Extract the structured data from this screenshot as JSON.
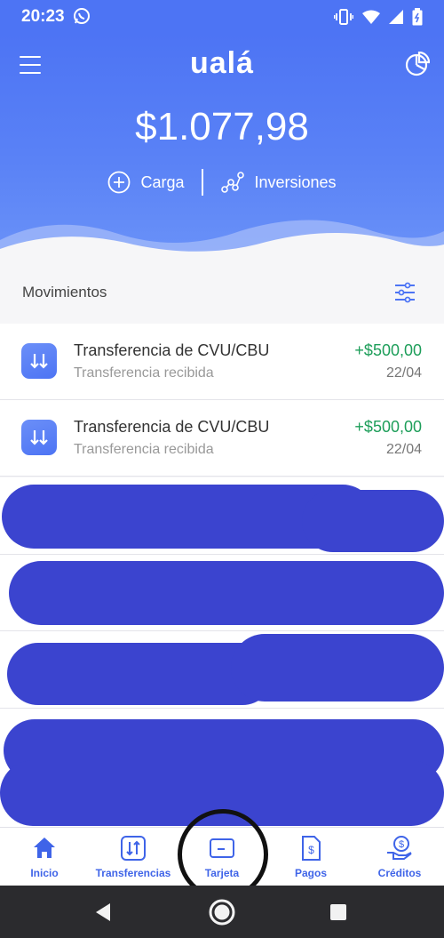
{
  "status_bar": {
    "time": "20:23"
  },
  "header": {
    "logo": "ualá",
    "balance": "$1.077,98"
  },
  "actions": {
    "load_label": "Carga",
    "invest_label": "Inversiones"
  },
  "movements": {
    "title": "Movimientos",
    "items": [
      {
        "title": "Transferencia de CVU/CBU",
        "subtitle": "Transferencia recibida",
        "amount": "+$500,00",
        "date": "22/04"
      },
      {
        "title": "Transferencia de CVU/CBU",
        "subtitle": "Transferencia recibida",
        "amount": "+$500,00",
        "date": "22/04"
      }
    ]
  },
  "bottom_nav": {
    "items": [
      {
        "label": "Inicio",
        "icon": "home-icon"
      },
      {
        "label": "Transferencias",
        "icon": "transfer-icon"
      },
      {
        "label": "Tarjeta",
        "icon": "card-icon"
      },
      {
        "label": "Pagos",
        "icon": "payment-icon"
      },
      {
        "label": "Créditos",
        "icon": "credit-icon"
      }
    ]
  },
  "colors": {
    "brand": "#4d74f4",
    "positive_amount": "#1e9e5a",
    "redaction": "#3b44cf",
    "nav_label": "#3f64e8"
  }
}
